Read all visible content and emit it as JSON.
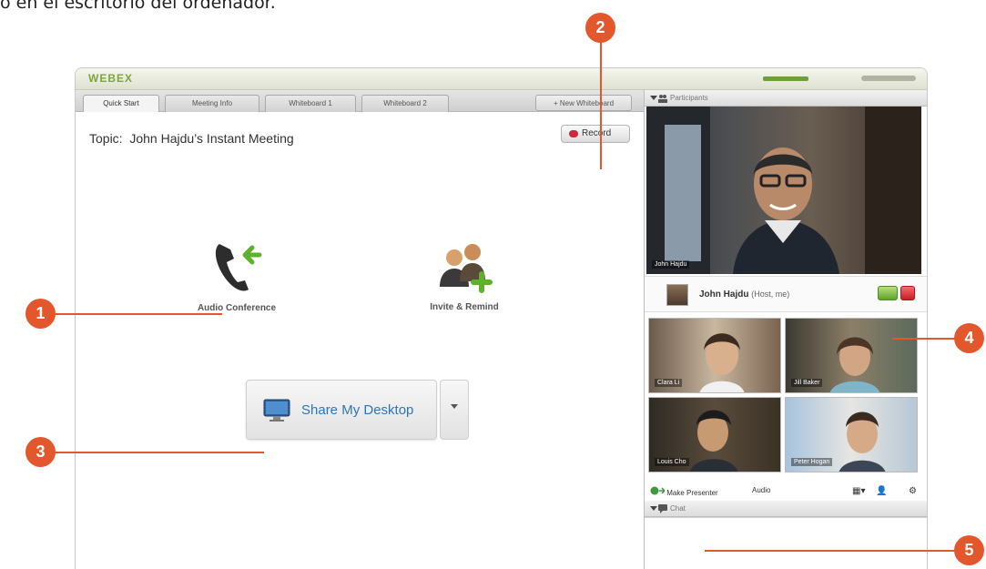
{
  "caption": "o en el escritorio del ordenador.",
  "app": {
    "logo": "WEBEX"
  },
  "tabs": [
    {
      "label": "Quick Start"
    },
    {
      "label": "Meeting Info"
    },
    {
      "label": "Whiteboard 1"
    },
    {
      "label": "Whiteboard 2"
    }
  ],
  "new_tab_label": "+ New Whiteboard",
  "main": {
    "topic_prefix": "Topic:",
    "topic": "John Hajdu’s Instant Meeting",
    "record_label": "Record",
    "audio_conference_label": "Audio Conference",
    "invite_label": "Invite & Remind",
    "share_label": "Share My Desktop"
  },
  "participants": {
    "header": "Participants",
    "main_video_name": "John Hajdu",
    "host_name": "John Hajdu",
    "host_role": "(Host, me)",
    "thumbs": [
      {
        "name": "Clara Li"
      },
      {
        "name": "Jill Baker"
      },
      {
        "name": "Louis Cho"
      },
      {
        "name": "Peter Hogan"
      }
    ],
    "toolbar": {
      "make_presenter": "Make Presenter",
      "audio": "Audio"
    }
  },
  "chat": {
    "header": "Chat"
  },
  "callouts": [
    "1",
    "2",
    "3",
    "4",
    "5"
  ],
  "colors": {
    "accent": "#e2572b",
    "link": "#2f74b8",
    "green": "#5ea22d",
    "red": "#c81e25"
  }
}
